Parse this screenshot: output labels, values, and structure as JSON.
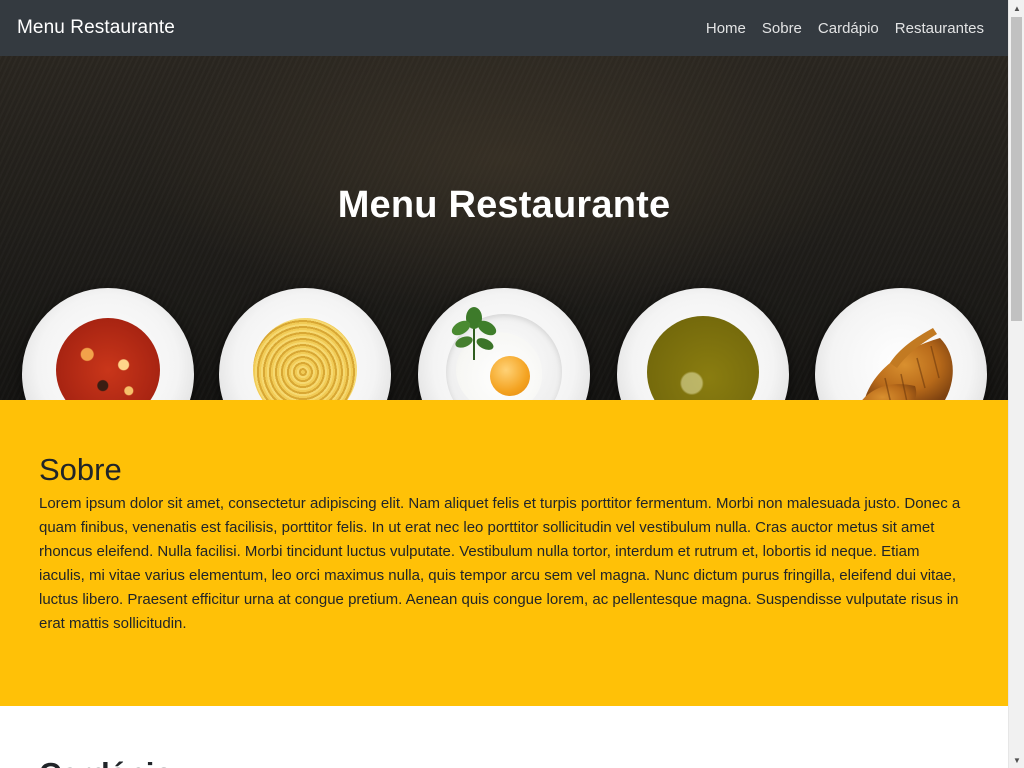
{
  "navbar": {
    "brand": "Menu Restaurante",
    "links": [
      "Home",
      "Sobre",
      "Cardápio",
      "Restaurantes"
    ]
  },
  "hero": {
    "title": "Menu Restaurante",
    "plates": [
      "tomato-soup",
      "spaghetti",
      "fried-egg",
      "pea-soup",
      "croissants"
    ]
  },
  "about": {
    "title": "Sobre",
    "text": "Lorem ipsum dolor sit amet, consectetur adipiscing elit. Nam aliquet felis et turpis porttitor fermentum. Morbi non malesuada justo. Donec a quam finibus, venenatis est facilisis, porttitor felis. In ut erat nec leo porttitor sollicitudin vel vestibulum nulla. Cras auctor metus sit amet rhoncus eleifend. Nulla facilisi. Morbi tincidunt luctus vulputate. Vestibulum nulla tortor, interdum et rutrum et, lobortis id neque. Etiam iaculis, mi vitae varius elementum, leo orci maximus nulla, quis tempor arcu sem vel magna. Nunc dictum purus fringilla, eleifend dui vitae, luctus libero. Praesent efficitur urna at congue pretium. Aenean quis congue lorem, ac pellentesque magna. Suspendisse vulputate risus in erat mattis sollicitudin."
  },
  "menu_section": {
    "title": "Cardápio"
  },
  "colors": {
    "navbar_bg": "#343a40",
    "about_bg": "#ffc107",
    "text": "#212529"
  }
}
